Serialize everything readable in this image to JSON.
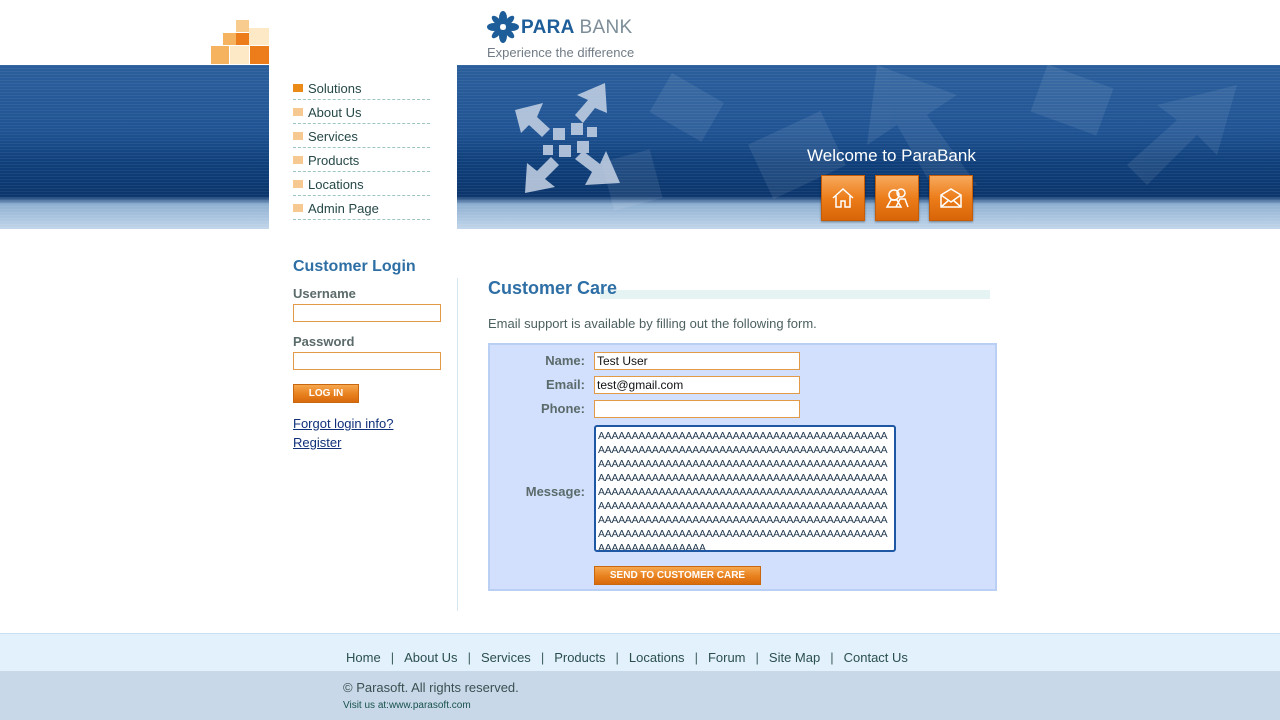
{
  "header": {
    "logo_para": "PARA",
    "logo_bank": "BANK",
    "tagline": "Experience the difference",
    "welcome": "Welcome to ParaBank",
    "icons": [
      "home-icon",
      "about-icon",
      "contact-icon"
    ],
    "accent_color": "#ec7d1a",
    "banner_color": "#1f5393"
  },
  "nav": {
    "items": [
      {
        "label": "Solutions"
      },
      {
        "label": "About Us"
      },
      {
        "label": "Services"
      },
      {
        "label": "Products"
      },
      {
        "label": "Locations"
      },
      {
        "label": "Admin Page"
      }
    ]
  },
  "login": {
    "title": "Customer Login",
    "username_label": "Username",
    "username_value": "",
    "password_label": "Password",
    "password_value": "",
    "button": "LOG IN",
    "forgot_link": "Forgot login info?",
    "register_link": "Register"
  },
  "main": {
    "title": "Customer Care",
    "intro": "Email support is available by filling out the following form.",
    "form": {
      "name_label": "Name:",
      "name_value": "Test User",
      "email_label": "Email:",
      "email_value": "test@gmail.com",
      "phone_label": "Phone:",
      "phone_value": "",
      "message_label": "Message:",
      "message_value": "AAAAAAAAAAAAAAAAAAAAAAAAAAAAAAAAAAAAAAAAAAAAAAAAAAAAAAAAAAAAAAAAAAAAAAAAAAAAAAAAAAAAAAAAAAAAAAAAAAAAAAAAAAAAAAAAAAAAAAAAAAAAAAAAAAAAAAAAAAAAAAAAAAAAAAAAAAAAAAAAAAAAAAAAAAAAAAAAAAAAAAAAAAAAAAAAAAAAAAAAAAAAAAAAAAAAAAAAAAAAAAAAAAAAAAAAAAAAAAAAAAAAAAAAAAAAAAAAAAAAAAAAAAAAAAAAAAAAAAAAAAAAAAAAAAAAAAAAAAAAAAAAAAAAAAAAAAAAAAAAAAAAAAAAAAAAAAAAAAAAAAAAAAAAAAAAAAAAAAAA",
      "send_button": "SEND TO CUSTOMER CARE"
    }
  },
  "footer": {
    "links": [
      "Home",
      "About Us",
      "Services",
      "Products",
      "Locations",
      "Forum",
      "Site Map",
      "Contact Us"
    ],
    "separator": "|",
    "copyright": "© Parasoft. All rights reserved.",
    "visit_prefix": "Visit us at:",
    "visit_link": "www.parasoft.com"
  }
}
